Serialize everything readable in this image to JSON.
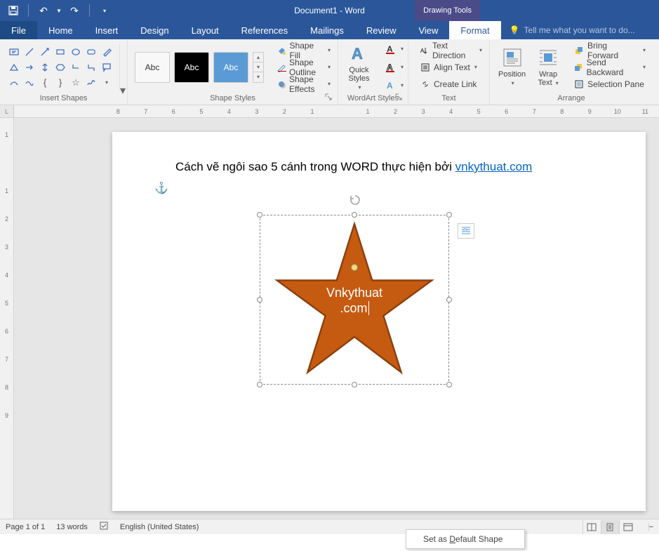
{
  "titlebar": {
    "title": "Document1 - Word",
    "tool_tab": "Drawing Tools"
  },
  "tabs": {
    "file": "File",
    "home": "Home",
    "insert": "Insert",
    "design": "Design",
    "layout": "Layout",
    "references": "References",
    "mailings": "Mailings",
    "review": "Review",
    "view": "View",
    "format": "Format",
    "tellme": "Tell me what you want to do..."
  },
  "groups": {
    "insert_shapes": "Insert Shapes",
    "shape_styles": "Shape Styles",
    "wordart_styles": "WordArt Styles",
    "text": "Text",
    "arrange": "Arrange"
  },
  "shape_styles": {
    "abc": "Abc",
    "fill": "Shape Fill",
    "outline": "Shape Outline",
    "effects": "Shape Effects"
  },
  "wordart": {
    "quick": "Quick",
    "styles": "Styles"
  },
  "text_group": {
    "direction": "Text Direction",
    "align": "Align Text",
    "link": "Create Link"
  },
  "arrange": {
    "position": "Position",
    "wrap": "Wrap",
    "text": "Text",
    "forward": "Bring Forward",
    "backward": "Send Backward",
    "selection": "Selection Pane"
  },
  "ruler_h": [
    "8",
    "7",
    "6",
    "5",
    "4",
    "3",
    "2",
    "1",
    "",
    "1",
    "2",
    "3",
    "4",
    "5",
    "6",
    "7",
    "8",
    "9",
    "10",
    "11"
  ],
  "ruler_v": [
    "1",
    "",
    "1",
    "2",
    "3",
    "4",
    "5",
    "6",
    "7",
    "8",
    "9"
  ],
  "doc": {
    "line_pre": "Cách vẽ ngôi sao 5 cánh trong WORD thực hiện bởi ",
    "link": "vnkythuat.com"
  },
  "star": {
    "line1": "Vnkythuat",
    "line2": ".com"
  },
  "status": {
    "page": "Page 1 of 1",
    "words": "13 words",
    "lang": "English (United States)"
  },
  "ctx": {
    "default": "Set as Default Shape",
    "d": "D"
  }
}
